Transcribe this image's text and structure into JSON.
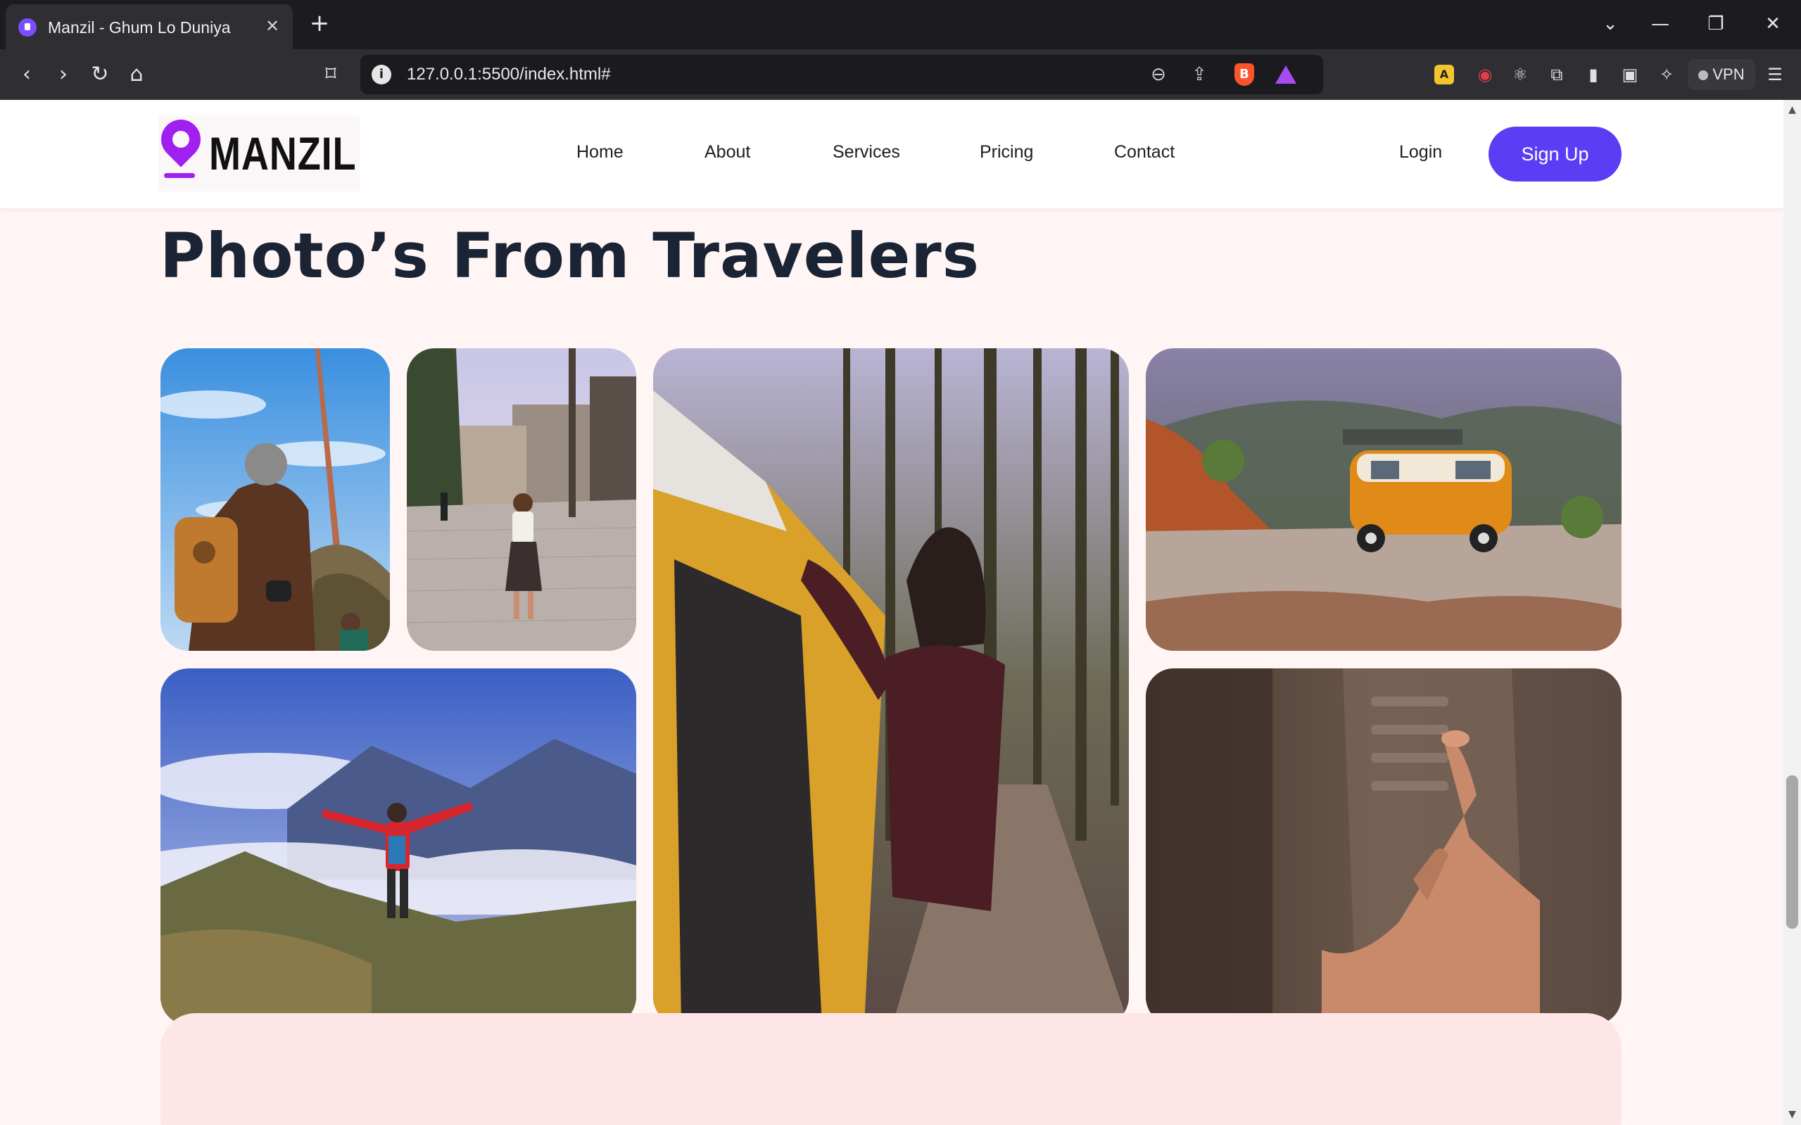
{
  "browser": {
    "tab_title": "Manzil - Ghum Lo Duniya",
    "tab_close_glyph": "✕",
    "new_tab_glyph": "+",
    "url": "127.0.0.1:5500/index.html#",
    "vpn_label": "VPN",
    "icons": {
      "back": "‹",
      "forward": "›",
      "reload": "↻",
      "home": "⌂",
      "bookmark": "⌑",
      "zoom": "⊖",
      "share": "⇪",
      "minimize": "—",
      "restore": "❐",
      "close": "✕",
      "dropdown": "⌄"
    }
  },
  "header": {
    "logo_text": "MANZIL",
    "nav": [
      "Home",
      "About",
      "Services",
      "Pricing",
      "Contact"
    ],
    "login_label": "Login",
    "signup_label": "Sign Up"
  },
  "gallery": {
    "title": "Photo’s From Travelers",
    "photos": [
      {
        "name": "hiker-with-backpack-photo",
        "subject": "hiker with backpack and tower"
      },
      {
        "name": "woman-walking-city-square-photo",
        "subject": "woman walking in city square"
      },
      {
        "name": "woman-in-van-forest-photo",
        "subject": "woman leaning out of yellow van in pine forest"
      },
      {
        "name": "orange-camper-van-photo",
        "subject": "orange camper van on rocky terrain"
      },
      {
        "name": "mountain-summit-photo",
        "subject": "person with arms outstretched on mountain summit"
      },
      {
        "name": "hand-on-stone-carving-photo",
        "subject": "hand touching stone carving"
      }
    ]
  },
  "colors": {
    "accent": "#5b3df5",
    "logo_purple": "#a020f0",
    "page_bg": "#fff5f4",
    "title": "#1b2434"
  }
}
